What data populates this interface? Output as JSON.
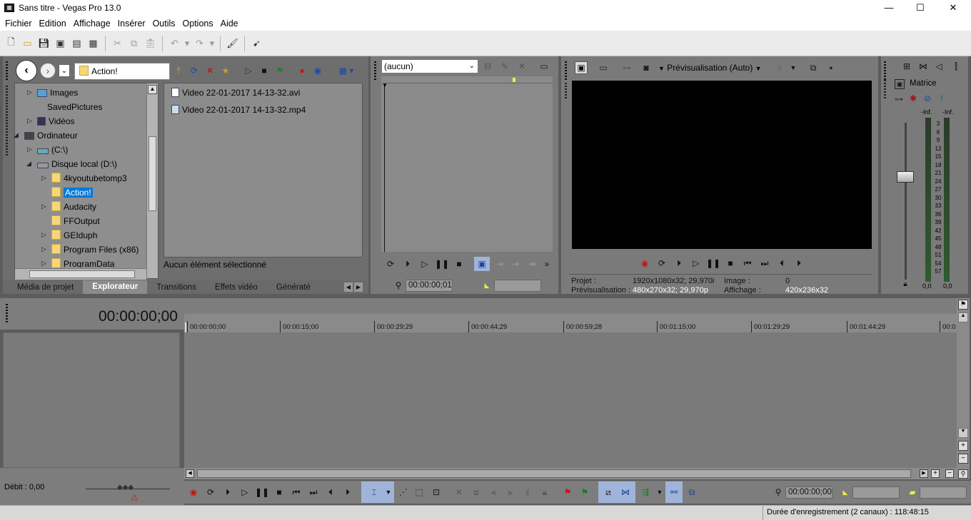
{
  "window": {
    "title": "Sans titre - Vegas Pro 13.0",
    "min_glyph": "—",
    "max_glyph": "☐",
    "close_glyph": "✕"
  },
  "menu": [
    "Fichier",
    "Edition",
    "Affichage",
    "Insérer",
    "Outils",
    "Options",
    "Aide"
  ],
  "explorer": {
    "path": "Action!",
    "tree": [
      {
        "label": "Images",
        "expanded": false
      },
      {
        "label": "SavedPictures",
        "expanded": null
      },
      {
        "label": "Vidéos",
        "expanded": false
      },
      {
        "label": "Ordinateur",
        "expanded": true
      },
      {
        "label": "(C:\\)",
        "expanded": false
      },
      {
        "label": "Disque local (D:\\)",
        "expanded": true
      },
      {
        "label": "4kyoutubetomp3",
        "expanded": false
      },
      {
        "label": "Action!",
        "expanded": null,
        "selected": true
      },
      {
        "label": "Audacity",
        "expanded": false
      },
      {
        "label": "FFOutput",
        "expanded": null
      },
      {
        "label": "GEIduph",
        "expanded": false
      },
      {
        "label": "Program Files (x86)",
        "expanded": false
      },
      {
        "label": "ProgramData",
        "expanded": false
      }
    ],
    "files": [
      "Video 22-01-2017 14-13-32.avi",
      "Video 22-01-2017 14-13-32.mp4"
    ],
    "status": "Aucun élément sélectionné",
    "tabs": [
      "Média de projet",
      "Explorateur",
      "Transitions",
      "Effets vidéo",
      "Génératé"
    ],
    "active_tab": "Explorateur"
  },
  "trimmer": {
    "selector": "(aucun)",
    "time": "00:00:00;01"
  },
  "preview": {
    "mode": "Prévisualisation (Auto)",
    "projet_label": "Projet :",
    "projet_value": "1920x1080x32; 29,970i",
    "previsu_label": "Prévisualisation :",
    "previsu_value": "480x270x32; 29,970p",
    "image_label": "Image :",
    "image_value": "0",
    "affichage_label": "Affichage :",
    "affichage_value": "420x236x32"
  },
  "mixer": {
    "label": "Matrice",
    "peak_left": "-Inf.",
    "peak_right": "-Inf.",
    "scale": [
      "3",
      "6",
      "9",
      "12",
      "15",
      "18",
      "21",
      "24",
      "27",
      "30",
      "33",
      "36",
      "39",
      "42",
      "45",
      "48",
      "51",
      "54",
      "57"
    ],
    "value_left": "0,0",
    "value_right": "0,0"
  },
  "timeline": {
    "current_time": "00:00:00;00",
    "ruler": [
      "00:00:00;00",
      "00:00:15;00",
      "00:00:29;29",
      "00:00:44;29",
      "00:00:59;28",
      "00:01:15;00",
      "00:01:29;29",
      "00:01:44;29",
      "00:0"
    ],
    "rate": "Débit : 0,00",
    "cursor_time": "00:00:00;00"
  },
  "status": {
    "text": "Durée d'enregistrement (2 canaux) : 118:48:15"
  },
  "colors": {
    "panel": "#7a7a7a",
    "selection": "#0078d7",
    "record": "#d01010"
  }
}
